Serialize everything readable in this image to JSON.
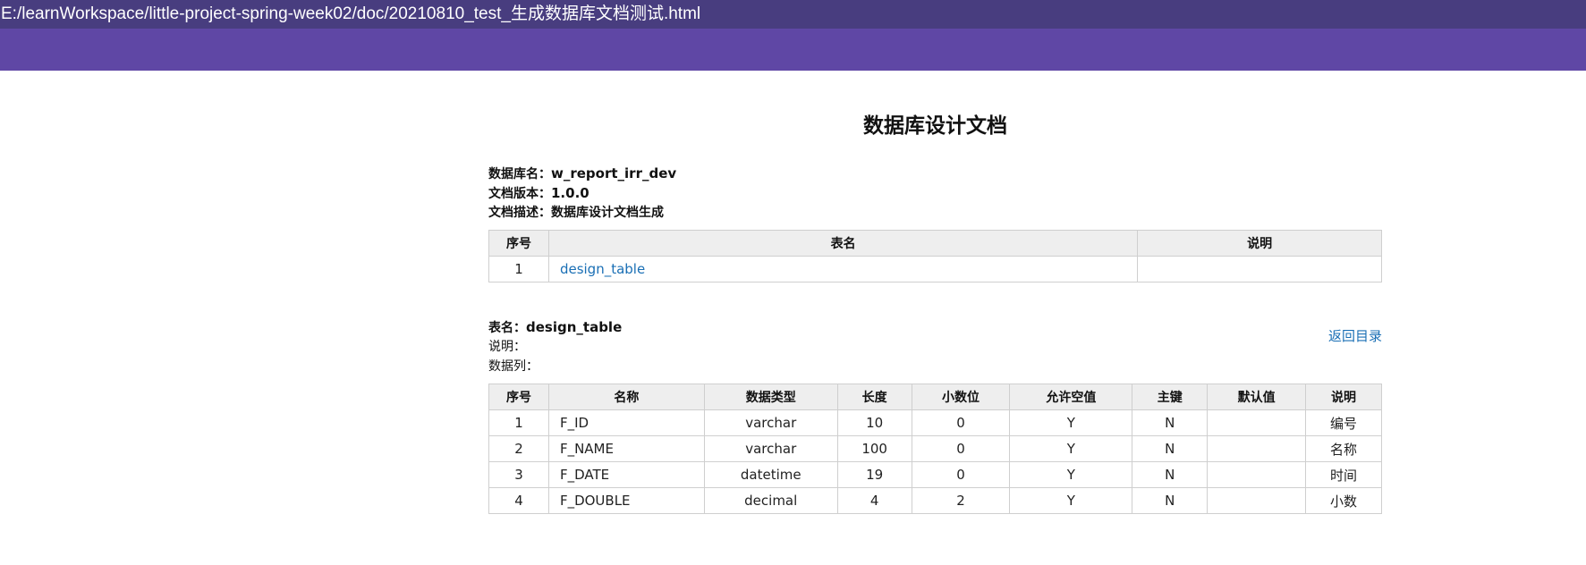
{
  "window": {
    "title": "E:/learnWorkspace/little-project-spring-week02/doc/20210810_test_生成数据库文档测试.html"
  },
  "doc": {
    "title": "数据库设计文档",
    "db_name_label": "数据库名：",
    "db_name": "w_report_irr_dev",
    "version_label": "文档版本：",
    "version": "1.0.0",
    "desc_label": "文档描述：",
    "desc": "数据库设计文档生成"
  },
  "toc": {
    "headers": [
      "序号",
      "表名",
      "说明"
    ],
    "rows": [
      {
        "no": "1",
        "name": "design_table",
        "comment": ""
      }
    ]
  },
  "table_detail": {
    "name_label": "表名：",
    "name": "design_table",
    "comment_label": "说明：",
    "columns_label": "数据列：",
    "back_label": "返回目录",
    "headers": [
      "序号",
      "名称",
      "数据类型",
      "长度",
      "小数位",
      "允许空值",
      "主键",
      "默认值",
      "说明"
    ],
    "rows": [
      [
        "1",
        "F_ID",
        "varchar",
        "10",
        "0",
        "Y",
        "N",
        "",
        "编号"
      ],
      [
        "2",
        "F_NAME",
        "varchar",
        "100",
        "0",
        "Y",
        "N",
        "",
        "名称"
      ],
      [
        "3",
        "F_DATE",
        "datetime",
        "19",
        "0",
        "Y",
        "N",
        "",
        "时间"
      ],
      [
        "4",
        "F_DOUBLE",
        "decimal",
        "4",
        "2",
        "Y",
        "N",
        "",
        "小数"
      ]
    ]
  }
}
